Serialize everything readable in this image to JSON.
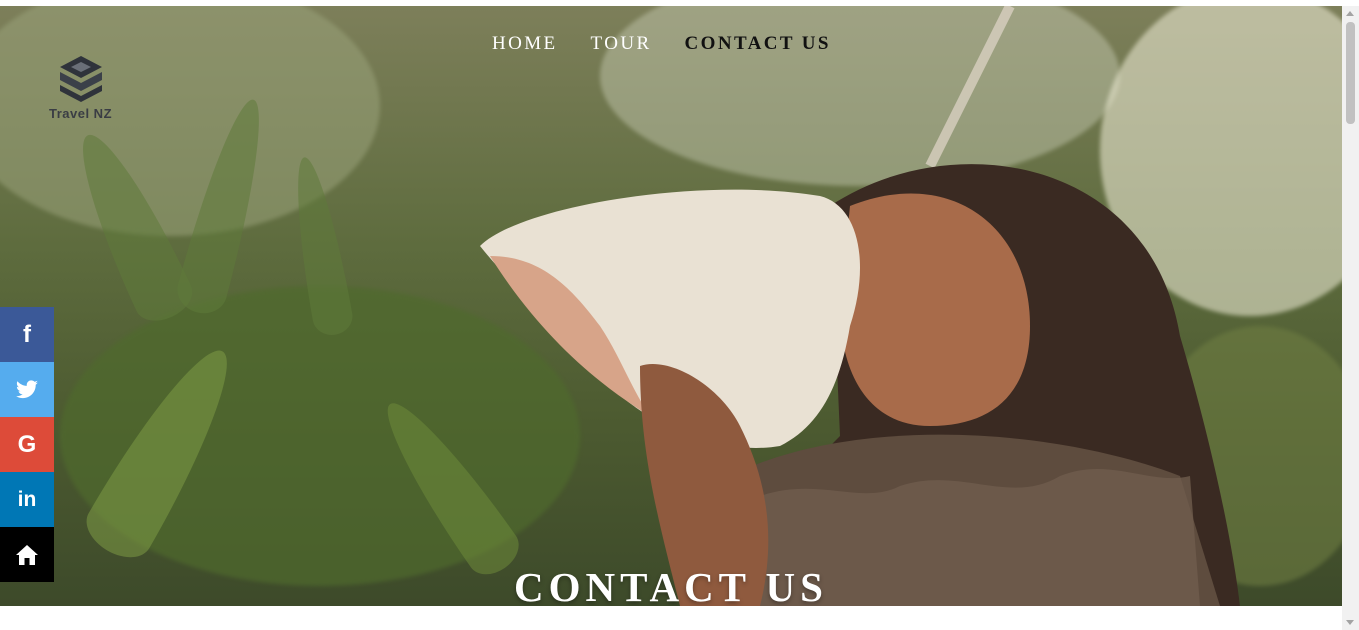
{
  "nav": {
    "items": [
      {
        "label": "HOME"
      },
      {
        "label": "TOUR"
      },
      {
        "label": "CONTACT US"
      }
    ]
  },
  "logo": {
    "text": "Travel NZ"
  },
  "hero": {
    "title": "CONTACT US"
  },
  "social": [
    {
      "name": "facebook-icon",
      "glyph": "f",
      "color": "#3b5998"
    },
    {
      "name": "twitter-icon",
      "glyph": "",
      "color": "#55acee"
    },
    {
      "name": "google-icon",
      "glyph": "G",
      "color": "#dd4b39"
    },
    {
      "name": "linkedin-icon",
      "glyph": "in",
      "color": "#0077b5"
    },
    {
      "name": "home-icon",
      "glyph": "",
      "color": "#000000"
    }
  ]
}
